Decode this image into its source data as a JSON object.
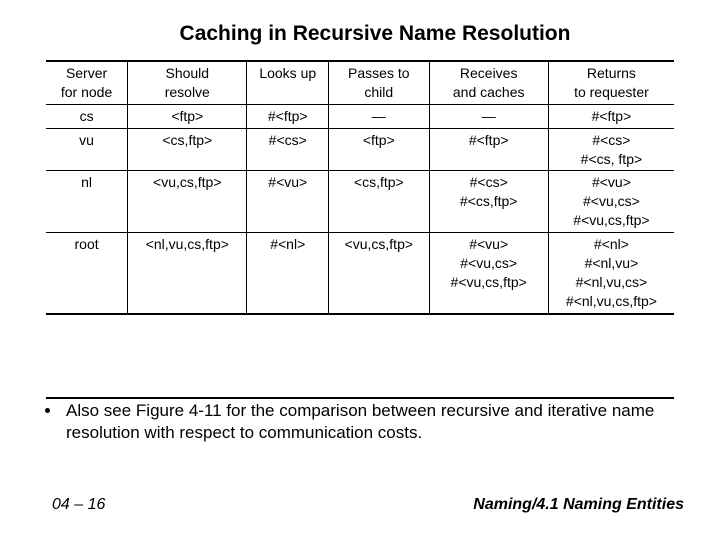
{
  "title": "Caching in Recursive Name Resolution",
  "headers": [
    [
      "Server",
      "for node"
    ],
    [
      "Should",
      "resolve"
    ],
    [
      "Looks up"
    ],
    [
      "Passes to",
      "child"
    ],
    [
      "Receives",
      "and caches"
    ],
    [
      "Returns",
      "to requester"
    ]
  ],
  "rows": [
    {
      "server": "cs",
      "resolve": "<ftp>",
      "looksup": "#<ftp>",
      "passes": "—",
      "receives": "—",
      "returns": [
        "#<ftp>"
      ]
    },
    {
      "server": "vu",
      "resolve": "<cs,ftp>",
      "looksup": "#<cs>",
      "passes": "<ftp>",
      "receives": "#<ftp>",
      "returns": [
        "#<cs>",
        "#<cs, ftp>"
      ]
    },
    {
      "server": "nl",
      "resolve": "<vu,cs,ftp>",
      "looksup": "#<vu>",
      "passes": "<cs,ftp>",
      "receives_lines": [
        "#<cs>",
        "#<cs,ftp>"
      ],
      "returns": [
        "#<vu>",
        "#<vu,cs>",
        "#<vu,cs,ftp>"
      ]
    },
    {
      "server": "root",
      "resolve": "<nl,vu,cs,ftp>",
      "looksup": "#<nl>",
      "passes": "<vu,cs,ftp>",
      "receives_lines": [
        "#<vu>",
        "#<vu,cs>",
        "#<vu,cs,ftp>"
      ],
      "returns": [
        "#<nl>",
        "#<nl,vu>",
        "#<nl,vu,cs>",
        "#<nl,vu,cs,ftp>"
      ]
    }
  ],
  "bullet": "Also see Figure 4-11 for the comparison between recursive and iterative name resolution with respect to communication costs.",
  "footer": {
    "page": "04 – 16",
    "section": "Naming/4.1 Naming Entities"
  }
}
